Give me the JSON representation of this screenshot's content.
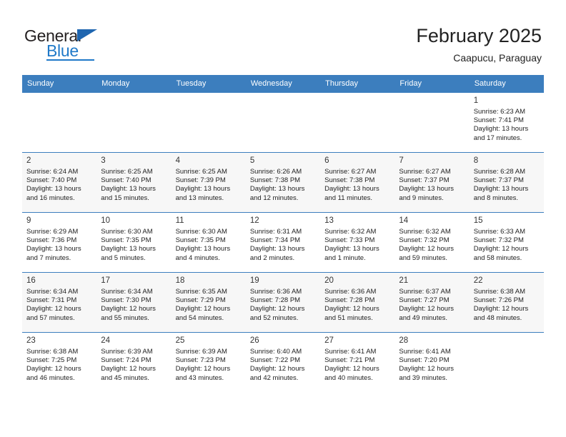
{
  "logo": {
    "word_one": "General",
    "word_two": "Blue",
    "triangle_icon": "triangle-icon"
  },
  "header": {
    "title": "February 2025",
    "subtitle": "Caapucu, Paraguay"
  },
  "colors": {
    "header_blue": "#3c7ebe",
    "logo_blue": "#1f79c8",
    "row_alt": "#f7f7f7"
  },
  "weekdays": [
    "Sunday",
    "Monday",
    "Tuesday",
    "Wednesday",
    "Thursday",
    "Friday",
    "Saturday"
  ],
  "weeks": [
    [
      {
        "empty": true
      },
      {
        "empty": true
      },
      {
        "empty": true
      },
      {
        "empty": true
      },
      {
        "empty": true
      },
      {
        "empty": true
      },
      {
        "day": "1",
        "sunrise": "Sunrise: 6:23 AM",
        "sunset": "Sunset: 7:41 PM",
        "daylight_1": "Daylight: 13 hours",
        "daylight_2": "and 17 minutes."
      }
    ],
    [
      {
        "day": "2",
        "sunrise": "Sunrise: 6:24 AM",
        "sunset": "Sunset: 7:40 PM",
        "daylight_1": "Daylight: 13 hours",
        "daylight_2": "and 16 minutes."
      },
      {
        "day": "3",
        "sunrise": "Sunrise: 6:25 AM",
        "sunset": "Sunset: 7:40 PM",
        "daylight_1": "Daylight: 13 hours",
        "daylight_2": "and 15 minutes."
      },
      {
        "day": "4",
        "sunrise": "Sunrise: 6:25 AM",
        "sunset": "Sunset: 7:39 PM",
        "daylight_1": "Daylight: 13 hours",
        "daylight_2": "and 13 minutes."
      },
      {
        "day": "5",
        "sunrise": "Sunrise: 6:26 AM",
        "sunset": "Sunset: 7:38 PM",
        "daylight_1": "Daylight: 13 hours",
        "daylight_2": "and 12 minutes."
      },
      {
        "day": "6",
        "sunrise": "Sunrise: 6:27 AM",
        "sunset": "Sunset: 7:38 PM",
        "daylight_1": "Daylight: 13 hours",
        "daylight_2": "and 11 minutes."
      },
      {
        "day": "7",
        "sunrise": "Sunrise: 6:27 AM",
        "sunset": "Sunset: 7:37 PM",
        "daylight_1": "Daylight: 13 hours",
        "daylight_2": "and 9 minutes."
      },
      {
        "day": "8",
        "sunrise": "Sunrise: 6:28 AM",
        "sunset": "Sunset: 7:37 PM",
        "daylight_1": "Daylight: 13 hours",
        "daylight_2": "and 8 minutes."
      }
    ],
    [
      {
        "day": "9",
        "sunrise": "Sunrise: 6:29 AM",
        "sunset": "Sunset: 7:36 PM",
        "daylight_1": "Daylight: 13 hours",
        "daylight_2": "and 7 minutes."
      },
      {
        "day": "10",
        "sunrise": "Sunrise: 6:30 AM",
        "sunset": "Sunset: 7:35 PM",
        "daylight_1": "Daylight: 13 hours",
        "daylight_2": "and 5 minutes."
      },
      {
        "day": "11",
        "sunrise": "Sunrise: 6:30 AM",
        "sunset": "Sunset: 7:35 PM",
        "daylight_1": "Daylight: 13 hours",
        "daylight_2": "and 4 minutes."
      },
      {
        "day": "12",
        "sunrise": "Sunrise: 6:31 AM",
        "sunset": "Sunset: 7:34 PM",
        "daylight_1": "Daylight: 13 hours",
        "daylight_2": "and 2 minutes."
      },
      {
        "day": "13",
        "sunrise": "Sunrise: 6:32 AM",
        "sunset": "Sunset: 7:33 PM",
        "daylight_1": "Daylight: 13 hours",
        "daylight_2": "and 1 minute."
      },
      {
        "day": "14",
        "sunrise": "Sunrise: 6:32 AM",
        "sunset": "Sunset: 7:32 PM",
        "daylight_1": "Daylight: 12 hours",
        "daylight_2": "and 59 minutes."
      },
      {
        "day": "15",
        "sunrise": "Sunrise: 6:33 AM",
        "sunset": "Sunset: 7:32 PM",
        "daylight_1": "Daylight: 12 hours",
        "daylight_2": "and 58 minutes."
      }
    ],
    [
      {
        "day": "16",
        "sunrise": "Sunrise: 6:34 AM",
        "sunset": "Sunset: 7:31 PM",
        "daylight_1": "Daylight: 12 hours",
        "daylight_2": "and 57 minutes."
      },
      {
        "day": "17",
        "sunrise": "Sunrise: 6:34 AM",
        "sunset": "Sunset: 7:30 PM",
        "daylight_1": "Daylight: 12 hours",
        "daylight_2": "and 55 minutes."
      },
      {
        "day": "18",
        "sunrise": "Sunrise: 6:35 AM",
        "sunset": "Sunset: 7:29 PM",
        "daylight_1": "Daylight: 12 hours",
        "daylight_2": "and 54 minutes."
      },
      {
        "day": "19",
        "sunrise": "Sunrise: 6:36 AM",
        "sunset": "Sunset: 7:28 PM",
        "daylight_1": "Daylight: 12 hours",
        "daylight_2": "and 52 minutes."
      },
      {
        "day": "20",
        "sunrise": "Sunrise: 6:36 AM",
        "sunset": "Sunset: 7:28 PM",
        "daylight_1": "Daylight: 12 hours",
        "daylight_2": "and 51 minutes."
      },
      {
        "day": "21",
        "sunrise": "Sunrise: 6:37 AM",
        "sunset": "Sunset: 7:27 PM",
        "daylight_1": "Daylight: 12 hours",
        "daylight_2": "and 49 minutes."
      },
      {
        "day": "22",
        "sunrise": "Sunrise: 6:38 AM",
        "sunset": "Sunset: 7:26 PM",
        "daylight_1": "Daylight: 12 hours",
        "daylight_2": "and 48 minutes."
      }
    ],
    [
      {
        "day": "23",
        "sunrise": "Sunrise: 6:38 AM",
        "sunset": "Sunset: 7:25 PM",
        "daylight_1": "Daylight: 12 hours",
        "daylight_2": "and 46 minutes."
      },
      {
        "day": "24",
        "sunrise": "Sunrise: 6:39 AM",
        "sunset": "Sunset: 7:24 PM",
        "daylight_1": "Daylight: 12 hours",
        "daylight_2": "and 45 minutes."
      },
      {
        "day": "25",
        "sunrise": "Sunrise: 6:39 AM",
        "sunset": "Sunset: 7:23 PM",
        "daylight_1": "Daylight: 12 hours",
        "daylight_2": "and 43 minutes."
      },
      {
        "day": "26",
        "sunrise": "Sunrise: 6:40 AM",
        "sunset": "Sunset: 7:22 PM",
        "daylight_1": "Daylight: 12 hours",
        "daylight_2": "and 42 minutes."
      },
      {
        "day": "27",
        "sunrise": "Sunrise: 6:41 AM",
        "sunset": "Sunset: 7:21 PM",
        "daylight_1": "Daylight: 12 hours",
        "daylight_2": "and 40 minutes."
      },
      {
        "day": "28",
        "sunrise": "Sunrise: 6:41 AM",
        "sunset": "Sunset: 7:20 PM",
        "daylight_1": "Daylight: 12 hours",
        "daylight_2": "and 39 minutes."
      },
      {
        "empty": true
      }
    ]
  ]
}
